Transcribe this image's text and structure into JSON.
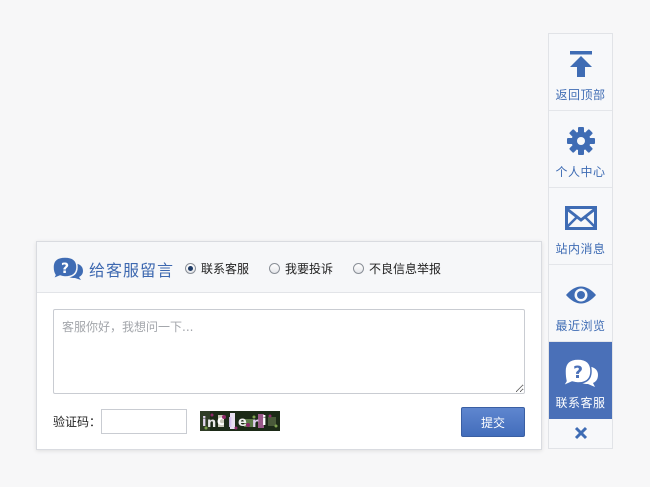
{
  "sidebar": {
    "items": [
      {
        "label": "返回顶部",
        "icon": "arrow-to-top-icon"
      },
      {
        "label": "个人中心",
        "icon": "gear-icon"
      },
      {
        "label": "站内消息",
        "icon": "envelope-icon"
      },
      {
        "label": "最近浏览",
        "icon": "eye-icon"
      },
      {
        "label": "联系客服",
        "icon": "question-chat-icon",
        "active": true
      }
    ],
    "close_icon": "close-icon",
    "accent_color": "#3f6cb4",
    "active_bg": "#4a70b8"
  },
  "panel": {
    "title": "给客服留言",
    "title_icon": "question-chat-icon",
    "options": [
      {
        "label": "联系客服",
        "checked": true
      },
      {
        "label": "我要投诉",
        "checked": false
      },
      {
        "label": "不良信息举报",
        "checked": false
      }
    ],
    "message": {
      "placeholder": "客服你好，我想问一下...",
      "value": ""
    },
    "captcha": {
      "label": "验证码：",
      "value": "",
      "image_icon": "captcha-image"
    },
    "submit_label": "提交"
  }
}
